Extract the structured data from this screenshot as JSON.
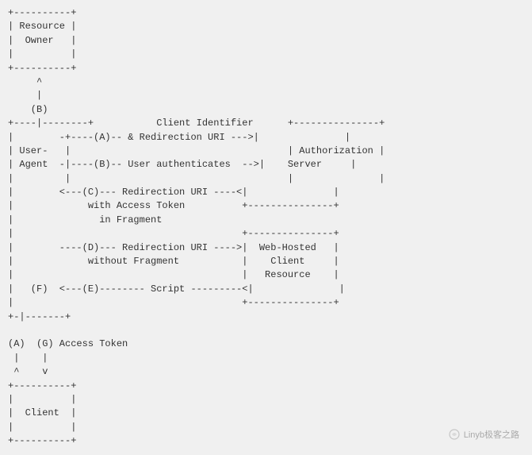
{
  "diagram": {
    "lines": [
      "+----------+",
      "| Resource |",
      "|  Owner   |",
      "|          |",
      "+----------+",
      "     ^",
      "     |",
      "    (B)",
      "+----|---------+               Client Identifier      +---------------+",
      "|         -+----(A)-- & Redirection URI --->|                |",
      "|  User-   |                                              | Authorization |",
      "|  Agent  -|----(B)-- User authenticates -->|    Server     |",
      "|          |                                              |               |",
      "|         <---(C)--- Redirection URI ----<|               |",
      "|              with Access Token          +---------------+",
      "|                in Fragment",
      "|                                              +---------------+",
      "|         ----(D)--- Redirection URI ---->| Web-Hosted    |",
      "|              without Fragment           |    Client     |",
      "|                                         |   Resource    |",
      "|    (F)  <---(E)-------- Script ---------<|               |",
      "|                                         +---------------+",
      "+-|---------+",
      "",
      "(A)  (G) Access Token",
      " |    |",
      " ^    v",
      "+----------+",
      "|          |",
      "|  Client  |",
      "|          |",
      "+----------+"
    ],
    "watermark": "Linyb极客之路"
  }
}
